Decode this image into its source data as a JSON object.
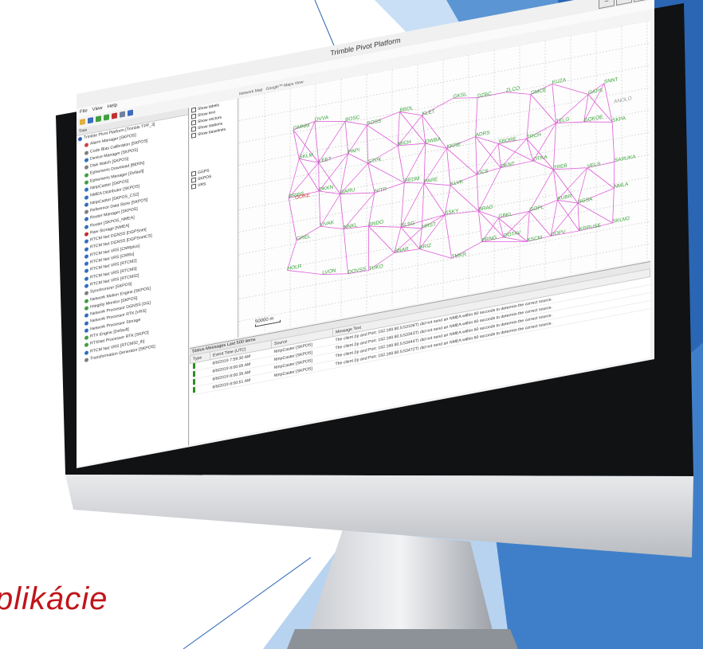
{
  "slide": {
    "title": "plikácie",
    "colors": {
      "accent_red": "#c0151a",
      "blue_dark": "#2a66b3",
      "blue_light": "#c9dff5",
      "blue_mid": "#5b95d3"
    }
  },
  "window": {
    "title": "Trimble Pivot Platform",
    "controls": [
      "–",
      "❐",
      "✕"
    ]
  },
  "menu": [
    "File",
    "View",
    "Help"
  ],
  "tree": {
    "header": "Tree",
    "items": [
      {
        "label": "Trimble Pivot Platform [Trimble TPP_3]",
        "color": "#3060c0"
      },
      {
        "label": "Alarm Manager [SKPOS]",
        "color": "#d04040"
      },
      {
        "label": "Code Bias Calibration [SKPOS]",
        "color": "#808080"
      },
      {
        "label": "Device Manager [SKPOS]",
        "color": "#3070c0"
      },
      {
        "label": "Disk Watch [SKPOS]",
        "color": "#808080"
      },
      {
        "label": "Ephemeris Download [BERN]",
        "color": "#40a040"
      },
      {
        "label": "Ephemeris Manager [Default]",
        "color": "#40a040"
      },
      {
        "label": "NtripCaster [SKPOS]",
        "color": "#3070c0"
      },
      {
        "label": "NMEA Distributor [SKPOS]",
        "color": "#3070c0"
      },
      {
        "label": "NtripCaster [SKPOS_CS2]",
        "color": "#3070c0"
      },
      {
        "label": "Reference Data Store [SKPOS]",
        "color": "#808080"
      },
      {
        "label": "Router Manager [SKPOS]",
        "color": "#3070c0"
      },
      {
        "label": "Router [SKPOS_NMEA]",
        "color": "#3070c0"
      },
      {
        "label": "Raw Storage [NMEA]",
        "color": "#c03030"
      },
      {
        "label": "RTCM Net DGNSS [DGPSnet]",
        "color": "#3070c0"
      },
      {
        "label": "RTCM Net DGNSS [DGPSnetCS]",
        "color": "#3070c0"
      },
      {
        "label": "RTCM Net VRS [CMRplus]",
        "color": "#3070c0"
      },
      {
        "label": "RTCM Net VRS [CMRx]",
        "color": "#3070c0"
      },
      {
        "label": "RTCM Net VRS [RTCM2]",
        "color": "#3070c0"
      },
      {
        "label": "RTCM Net VRS [RTCM3]",
        "color": "#3070c0"
      },
      {
        "label": "RTCM Net VRS [RTCM32]",
        "color": "#3070c0"
      },
      {
        "label": "Synchronizer [SKPOS]",
        "color": "#808080"
      },
      {
        "label": "Network Motion Engine [SKPOS]",
        "color": "#40a040"
      },
      {
        "label": "Integrity Monitor [SKPOS]",
        "color": "#40a040"
      },
      {
        "label": "Network Processor DGNSS [DG]",
        "color": "#3070c0"
      },
      {
        "label": "Network Processor RTK [VRS]",
        "color": "#3070c0"
      },
      {
        "label": "Network Processor Storage",
        "color": "#3070c0"
      },
      {
        "label": "RTX Engine [Default]",
        "color": "#40a040"
      },
      {
        "label": "RTXNet Processor RTK [SKPO]",
        "color": "#40a040"
      },
      {
        "label": "RTCM Net VRS [RTCM32_lb]",
        "color": "#3070c0"
      },
      {
        "label": "Transformation Generator [SKPOS]",
        "color": "#808080"
      }
    ]
  },
  "layers": {
    "tabs": [
      "Network Map",
      "Google™ Maps View"
    ],
    "options": [
      "Show labels",
      "Show text",
      "Show vectors",
      "Show stations",
      "Show baselines"
    ],
    "groups": [
      "GGPS",
      "SKPOS",
      "VRS"
    ]
  },
  "map": {
    "stations_green": [
      "GMNM",
      "DVVA",
      "BOSC",
      "BOSS",
      "BBDL",
      "KLET",
      "GKSL",
      "DZBC",
      "ZLCO",
      "GMCE",
      "KUZA",
      "GAPS",
      "SNNT",
      "SKLM",
      "LEET",
      "PAPI",
      "STPK",
      "MICH",
      "DWBA",
      "KKRE",
      "ADRS",
      "SBORE",
      "TRCH",
      "TELG",
      "GOKOE",
      "SKPA",
      "BRIBS",
      "DKKN",
      "GARU",
      "NITR",
      "REDM",
      "PARE",
      "KLVK",
      "LICS",
      "DKNT",
      "OTKA",
      "TREB",
      "VELS",
      "SARUKA",
      "GREL",
      "UVAK",
      "NNKL",
      "BNDO",
      "SLSG",
      "HRST",
      "SSKY",
      "BRAD",
      "GBKL",
      "GOPL",
      "KUBR",
      "NGSA",
      "NMLA",
      "HOLR",
      "LVON",
      "DOVSS",
      "TUKO",
      "SNAR",
      "BRIZ",
      "TMKR",
      "PRNG",
      "DOTAV",
      "KSCM",
      "DOPV",
      "KRRUSE",
      "SKLM2"
    ],
    "station_red": "GOKE",
    "station_grey": "ANOLO",
    "scale_label": "50000 m"
  },
  "status": {
    "header": "Status Messages  Last 500 items",
    "columns": [
      "Type",
      "Event Time (UTC)",
      "Source",
      "Message Text"
    ],
    "rows": [
      {
        "time": "6/6/2019 7:59:30 AM",
        "source": "NtripCaster [SKPOS]",
        "message": "The client (Ip and Port: 192.168.80.5:53106T) did not send an NMEA within 60 seconds to determin the correct source."
      },
      {
        "time": "6/6/2019 8:00:05 AM",
        "source": "NtripCaster [SKPOS]",
        "message": "The client (Ip and Port: 192.168.80.5:53343T) did not send an NMEA within 60 seconds to determin the correct source."
      },
      {
        "time": "6/6/2019 8:00:35 AM",
        "source": "NtripCaster [SKPOS]",
        "message": "The client (Ip and Port: 192.168.80.5:53444T) did not send an NMEA within 60 seconds to determin the correct source."
      },
      {
        "time": "6/6/2019 8:00:51 AM",
        "source": "NtripCaster [SKPOS]",
        "message": "The client (Ip and Port: 192.168.80.5:53472T) did not send an NMEA within 60 seconds to determin the correct source."
      }
    ]
  }
}
